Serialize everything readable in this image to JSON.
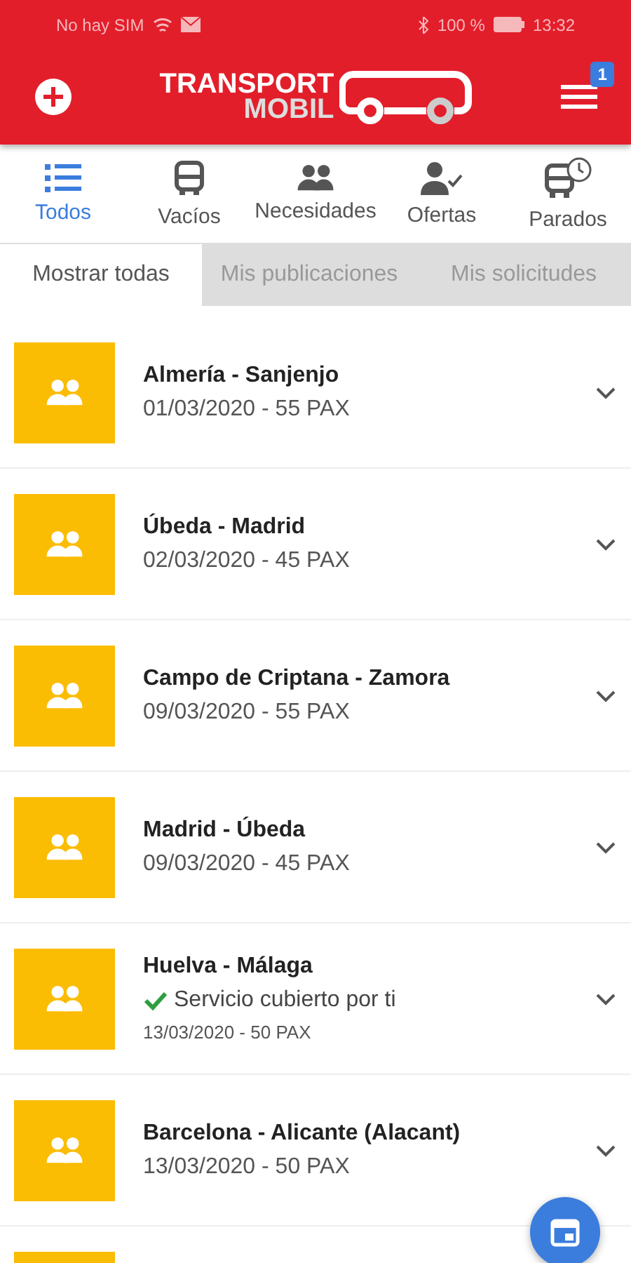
{
  "status_bar": {
    "carrier": "No hay SIM",
    "battery": "100 %",
    "time": "13:32"
  },
  "header": {
    "logo_top": "TRANSPORT",
    "logo_bottom": "MOBIL",
    "badge": "1"
  },
  "tabs": [
    {
      "label": "Todos",
      "kind": "list",
      "selected": true
    },
    {
      "label": "Vacíos",
      "kind": "bus",
      "selected": false
    },
    {
      "label": "Necesidades",
      "kind": "group",
      "selected": false
    },
    {
      "label": "Ofertas",
      "kind": "offer",
      "selected": false
    },
    {
      "label": "Parados",
      "kind": "stopped",
      "selected": false
    }
  ],
  "filters": [
    {
      "label": "Mostrar todas",
      "selected": true
    },
    {
      "label": "Mis publicaciones",
      "selected": false
    },
    {
      "label": "Mis solicitudes",
      "selected": false
    }
  ],
  "items": [
    {
      "kind": "trip",
      "title": "Almería - Sanjenjo",
      "detail": "01/03/2020 - 55 PAX"
    },
    {
      "kind": "trip",
      "title": "Úbeda - Madrid",
      "detail": "02/03/2020 - 45 PAX"
    },
    {
      "kind": "trip",
      "title": "Campo de Criptana - Zamora",
      "detail": "09/03/2020 - 55 PAX"
    },
    {
      "kind": "trip",
      "title": "Madrid - Úbeda",
      "detail": "09/03/2020 - 45 PAX"
    },
    {
      "kind": "trip",
      "title": "Huelva - Málaga",
      "status": "Servicio cubierto por ti",
      "detail": "13/03/2020 - 50 PAX"
    },
    {
      "kind": "trip",
      "title": "Barcelona - Alicante (Alacant)",
      "detail": "13/03/2020 - 50 PAX"
    },
    {
      "kind": "partial"
    }
  ]
}
